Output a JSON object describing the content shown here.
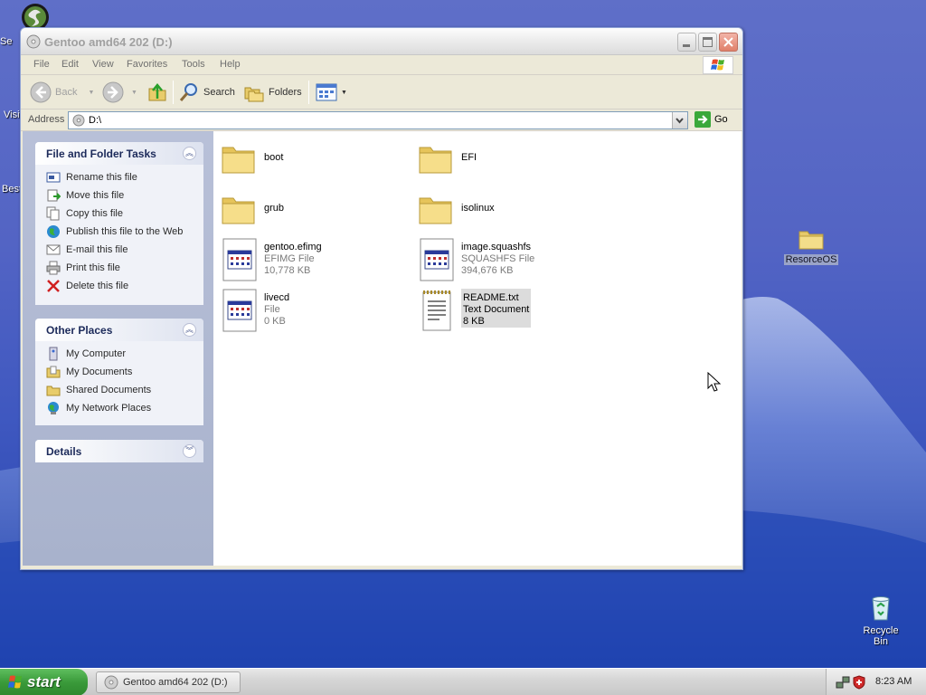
{
  "window": {
    "title": "Gentoo amd64 202 (D:)"
  },
  "menu": [
    "File",
    "Edit",
    "View",
    "Favorites",
    "Tools",
    "Help"
  ],
  "toolbar": {
    "back": "Back",
    "search": "Search",
    "folders": "Folders"
  },
  "address": {
    "label": "Address",
    "value": "D:\\",
    "go": "Go"
  },
  "tasks_panel": {
    "title": "File and Folder Tasks",
    "items": [
      "Rename this file",
      "Move this file",
      "Copy this file",
      "Publish this file to the Web",
      "E-mail this file",
      "Print this file",
      "Delete this file"
    ]
  },
  "places_panel": {
    "title": "Other Places",
    "items": [
      "My Computer",
      "My Documents",
      "Shared Documents",
      "My Network Places"
    ]
  },
  "details_panel": {
    "title": "Details"
  },
  "files": [
    {
      "name": "boot",
      "type": "",
      "size": "",
      "icon": "folder-icon"
    },
    {
      "name": "EFI",
      "type": "",
      "size": "",
      "icon": "folder-icon"
    },
    {
      "name": "grub",
      "type": "",
      "size": "",
      "icon": "folder-icon"
    },
    {
      "name": "isolinux",
      "type": "",
      "size": "",
      "icon": "folder-icon"
    },
    {
      "name": "gentoo.efimg",
      "type": "EFIMG File",
      "size": "10,778 KB",
      "icon": "generic-file-icon"
    },
    {
      "name": "image.squashfs",
      "type": "SQUASHFS File",
      "size": "394,676 KB",
      "icon": "generic-file-icon"
    },
    {
      "name": "livecd",
      "type": "File",
      "size": "0 KB",
      "icon": "generic-file-icon"
    },
    {
      "name": "README.txt",
      "type": "Text Document",
      "size": "8 KB",
      "icon": "text-document-icon"
    }
  ],
  "desktop": {
    "folder_label": "ResorceOS",
    "recycle_label": "Recycle Bin",
    "left_partial": [
      "Se",
      "Visit",
      "Best"
    ]
  },
  "taskbar": {
    "start": "start",
    "task": "Gentoo amd64 202 (D:)",
    "clock": "8:23 AM"
  }
}
